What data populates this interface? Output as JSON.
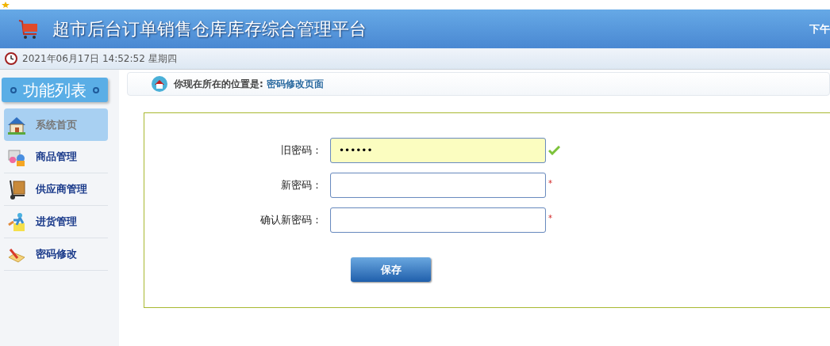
{
  "header": {
    "title": "超市后台订单销售仓库库存综合管理平台",
    "greeting": "下午"
  },
  "datetime": "2021年06月17日 14:52:52 星期四",
  "sidebar": {
    "title": "功能列表",
    "items": [
      {
        "label": "系统首页",
        "selected": true
      },
      {
        "label": "商品管理",
        "selected": false
      },
      {
        "label": "供应商管理",
        "selected": false
      },
      {
        "label": "进货管理",
        "selected": false
      },
      {
        "label": "密码修改",
        "selected": false
      }
    ]
  },
  "breadcrumb": {
    "prefix": "你现在所在的位置是:",
    "current": "密码修改页面"
  },
  "form": {
    "fields": [
      {
        "label": "旧密码：",
        "value": "••••••",
        "kind": "valid"
      },
      {
        "label": "新密码：",
        "mark": "*",
        "kind": "required"
      },
      {
        "label": "确认新密码：",
        "mark": "*",
        "kind": "required"
      }
    ],
    "button": "保存"
  }
}
